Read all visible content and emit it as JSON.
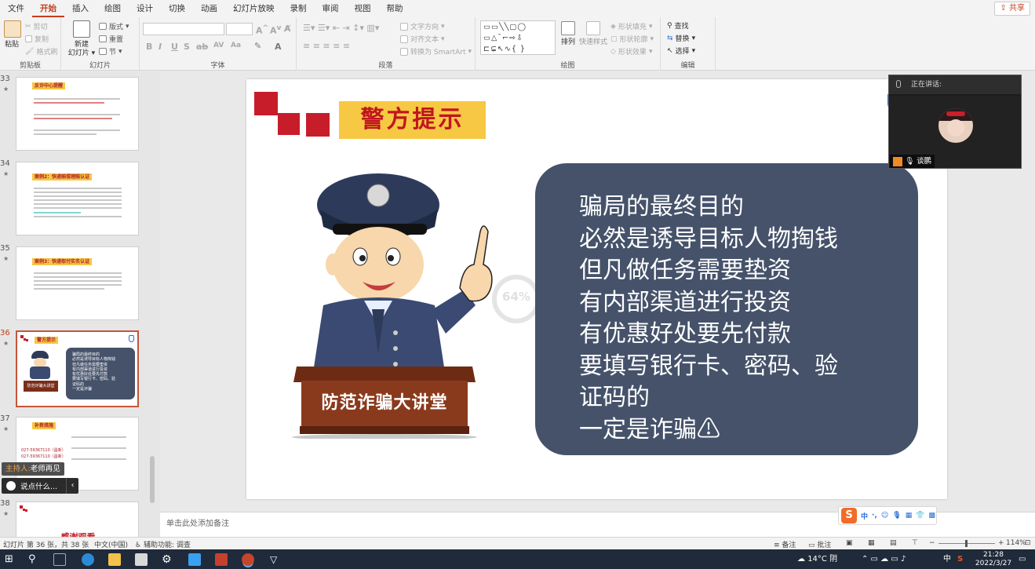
{
  "menu": {
    "tabs": [
      "文件",
      "开始",
      "插入",
      "绘图",
      "设计",
      "切换",
      "动画",
      "幻灯片放映",
      "录制",
      "审阅",
      "视图",
      "帮助"
    ],
    "active_index": 1,
    "share_label": "共享"
  },
  "ribbon": {
    "clipboard": {
      "paste": "粘贴",
      "cut": "剪切",
      "copy": "复制",
      "format_painter": "格式刷",
      "label": "剪贴板"
    },
    "slides": {
      "new_slide": "新建\n幻灯片",
      "layout": "版式",
      "reset": "重置",
      "section": "节",
      "label": "幻灯片"
    },
    "font": {
      "label": "字体"
    },
    "paragraph": {
      "text_direction": "文字方向",
      "align_text": "对齐文本",
      "convert_smartart": "转换为 SmartArt",
      "label": "段落"
    },
    "drawing": {
      "arrange": "排列",
      "quick_styles": "快速样式",
      "shape_fill": "形状填充",
      "shape_outline": "形状轮廓",
      "shape_effects": "形状效果",
      "label": "绘图"
    },
    "editing": {
      "find": "查找",
      "replace": "替换",
      "select": "选择",
      "label": "编辑"
    }
  },
  "slide_panel": {
    "thumbnails": [
      {
        "num": "33",
        "title": "反诈中心提醒"
      },
      {
        "num": "34",
        "title": "案例2：快递赔偿理赔认证"
      },
      {
        "num": "35",
        "title": "案例3：快递取付实名认证"
      },
      {
        "num": "36",
        "title": "警方提示",
        "active": true
      },
      {
        "num": "37",
        "title": "补救措施"
      },
      {
        "num": "38",
        "title": "感谢观看"
      }
    ],
    "thumb36": {
      "lines": [
        "骗局的最终目的",
        "必然是诱导目标人物掏钱",
        "但凡做任务需要垫资",
        "有内部渠道进行投资",
        "有优惠好处要先付款",
        "要填写银行卡、密码、验",
        "证码的",
        "一定是诈骗"
      ],
      "podium": "防范诈骗大讲堂"
    },
    "thumb37": {
      "phone1": "027-59367110（昌新）",
      "phone2": "027-59367110（昌新）"
    }
  },
  "slide": {
    "title": "警方提示",
    "bubble_lines": [
      "骗局的最终目的",
      "必然是诱导目标人物掏钱",
      "但凡做任务需要垫资",
      "有内部渠道进行投资",
      "有优惠好处要先付款",
      "要填写银行卡、密码、验",
      "证码的",
      "一定是诈骗⚠"
    ],
    "podium_text": "防范诈骗大讲堂",
    "loading_percent": "64%"
  },
  "notes": {
    "placeholder": "单击此处添加备注"
  },
  "meeting": {
    "speaking_label": "正在讲话:",
    "speaker_name": "谈鹏",
    "host_role": "主持人:",
    "host_name": "老师再见",
    "comment_placeholder": "说点什么..."
  },
  "status": {
    "slide_info": "幻灯片 第 36 张，共 38 张",
    "language": "中文(中国)",
    "accessibility": "辅助功能: 调查",
    "notes_btn": "备注",
    "comments_btn": "批注",
    "zoom": "114%"
  },
  "taskbar": {
    "weather": "14°C 阴",
    "ime": "中",
    "time": "21:28",
    "date": "2022/3/27"
  },
  "colors": {
    "accent": "#c43e1c",
    "bubble": "#45526a",
    "banner": "#f7c843",
    "title_red": "#c0161f"
  }
}
